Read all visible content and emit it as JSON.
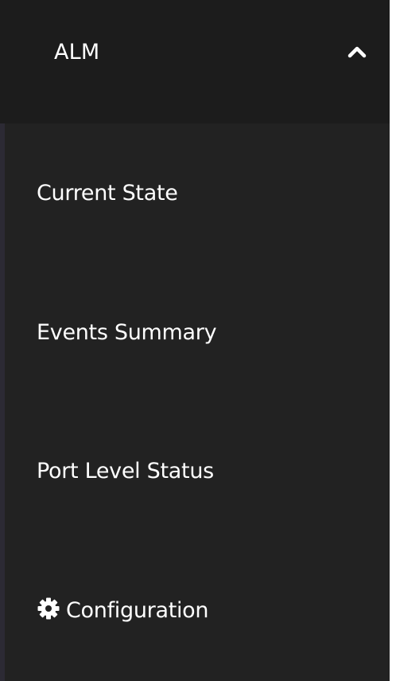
{
  "accordion": {
    "title": "ALM",
    "state_icon": "chevron-up-icon",
    "expanded": true
  },
  "menu": {
    "items": [
      {
        "label": "Current State"
      },
      {
        "label": "Events Summary"
      },
      {
        "label": "Port Level Status"
      },
      {
        "label": "Configuration",
        "icon": "gear-icon"
      }
    ]
  },
  "colors": {
    "background": "#222222",
    "header_background": "#1c1c1c",
    "text": "#ffffff",
    "rail": "#2c2a34"
  }
}
